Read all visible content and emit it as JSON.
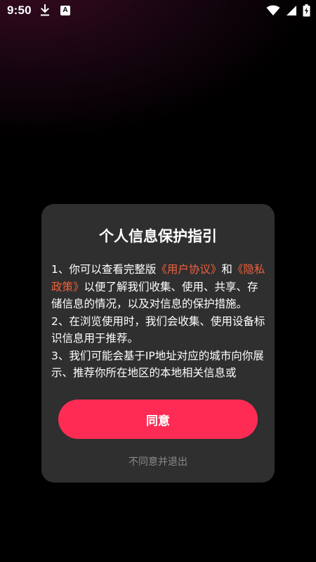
{
  "status_bar": {
    "time": "9:50",
    "left_icons": [
      "download-icon",
      "a-icon"
    ],
    "a_icon_label": "A",
    "right_icons": [
      "wifi-icon",
      "signal-icon",
      "battery-icon"
    ]
  },
  "dialog": {
    "title": "个人信息保护指引",
    "body": {
      "p1_prefix": "1、你可以查看完整版",
      "user_agreement_link": "《用户协议》",
      "p1_and": "和",
      "privacy_policy_link": "《隐私政策》",
      "p1_suffix": "以便了解我们收集、使用、共享、存储信息的情况，以及对信息的保护措施。",
      "p2": "2、在浏览使用时，我们会收集、使用设备标识信息用于推荐。",
      "p3": "3、我们可能会基于IP地址对应的城市向你展示、推荐你所在地区的本地相关信息或"
    },
    "agree_label": "同意",
    "disagree_label": "不同意并退出"
  },
  "colors": {
    "background": "#000000",
    "dialog_bg": "#2f2f2f",
    "accent": "#fe2c55",
    "link": "#f0603c"
  }
}
